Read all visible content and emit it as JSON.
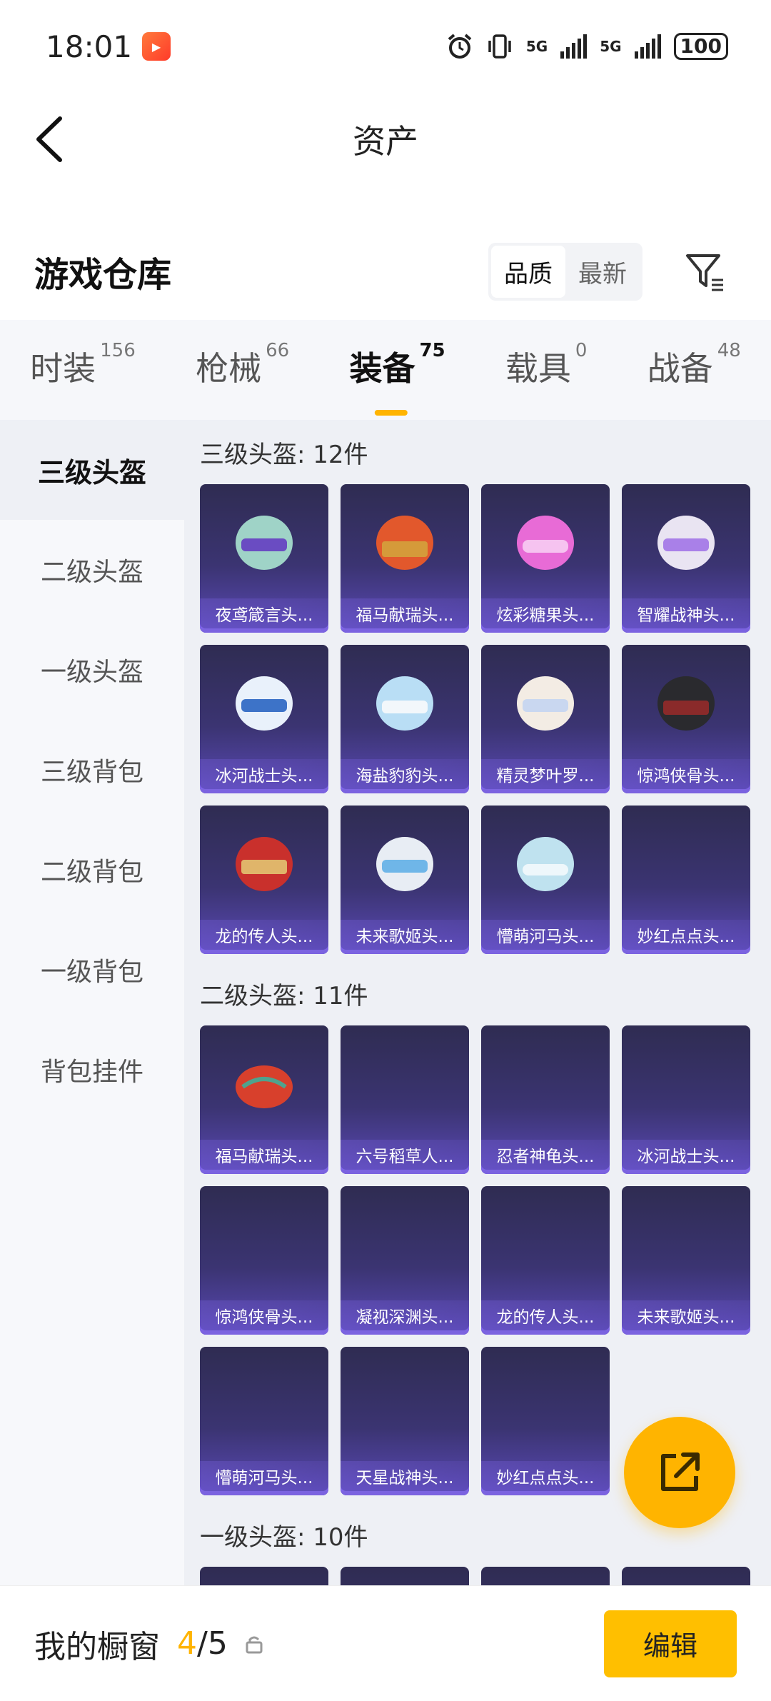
{
  "status_bar": {
    "time": "18:01",
    "network_1": "5G",
    "network_2": "5G",
    "battery": "100"
  },
  "header": {
    "title": "资产"
  },
  "warehouse": {
    "title": "游戏仓库",
    "sort_options": [
      "品质",
      "最新"
    ],
    "active_sort": "品质"
  },
  "tabs": [
    {
      "label": "时装",
      "count": "156"
    },
    {
      "label": "枪械",
      "count": "66"
    },
    {
      "label": "装备",
      "count": "75",
      "active": true
    },
    {
      "label": "载具",
      "count": "0"
    },
    {
      "label": "战备",
      "count": "48"
    }
  ],
  "sidebar": {
    "items": [
      "三级头盔",
      "二级头盔",
      "一级头盔",
      "三级背包",
      "二级背包",
      "一级背包",
      "背包挂件"
    ],
    "active": "三级头盔"
  },
  "sections": [
    {
      "title": "三级头盔: 12件",
      "items": [
        "夜鸢箴言头...",
        "福马献瑞头...",
        "炫彩糖果头...",
        "智耀战神头...",
        "冰河战士头...",
        "海盐豹豹头...",
        "精灵梦叶罗...",
        "惊鸿侠骨头...",
        "龙的传人头...",
        "未来歌姬头...",
        "懵萌河马头...",
        "妙红点点头..."
      ]
    },
    {
      "title": "二级头盔: 11件",
      "items": [
        "福马献瑞头...",
        "六号稻草人...",
        "忍者神龟头...",
        "冰河战士头...",
        "惊鸿侠骨头...",
        "凝视深渊头...",
        "龙的传人头...",
        "未来歌姬头...",
        "懵萌河马头...",
        "天星战神头...",
        "妙红点点头..."
      ]
    },
    {
      "title": "一级头盔: 10件",
      "items": []
    }
  ],
  "bottom_bar": {
    "label": "我的橱窗",
    "current": "4",
    "separator": "/",
    "total": "5",
    "edit_label": "编辑"
  },
  "colors": {
    "accent": "#ffb400",
    "card_bg": "#3b3472",
    "card_border": "#7b63e0"
  }
}
